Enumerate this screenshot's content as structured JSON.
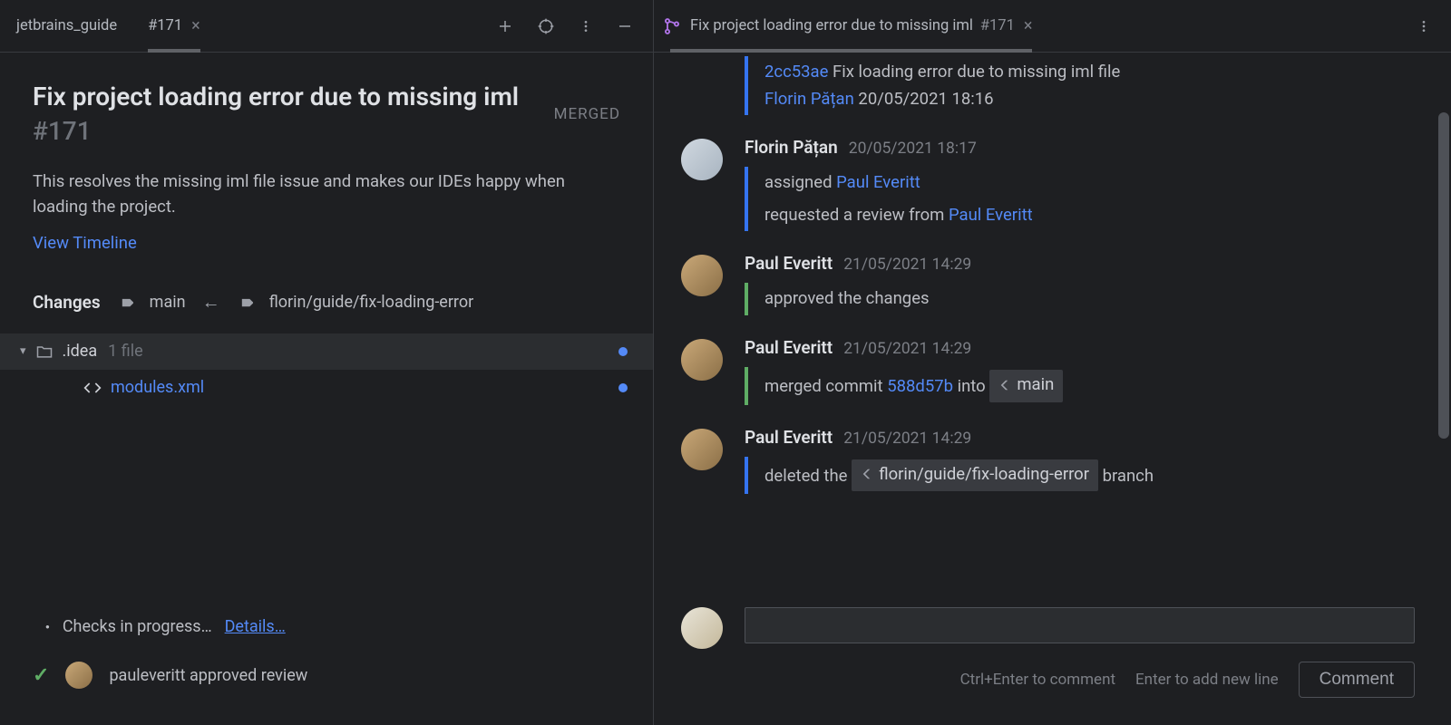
{
  "left": {
    "tabs": [
      {
        "label": "jetbrains_guide",
        "active": false
      },
      {
        "label": "#171",
        "active": true
      }
    ],
    "pr_title": "Fix project loading error due to missing iml",
    "pr_number": "#171",
    "pr_status": "MERGED",
    "description": "This resolves the missing iml file issue and makes our IDEs happy when loading the project.",
    "view_timeline": "View Timeline",
    "changes_label": "Changes",
    "base_branch": "main",
    "head_branch": "florin/guide/fix-loading-error",
    "folder": ".idea",
    "folder_count": "1 file",
    "file": "modules.xml",
    "checks": "Checks in progress…",
    "details": "Details…",
    "approval": {
      "user": "pauleveritt",
      "text": "approved review"
    }
  },
  "right": {
    "tab_title": "Fix project loading error due to missing iml",
    "tab_number": "#171",
    "partial": {
      "commit_hash": "2cc53ae",
      "commit_msg": "Fix loading error due to missing iml file",
      "author": "Florin Pățan",
      "time": "20/05/2021 18:16"
    },
    "items": [
      {
        "author": "Florin Pățan",
        "time": "20/05/2021 18:17",
        "avatar": "florin",
        "events": [
          {
            "color": "blue",
            "html": "assigned <span class='link'>Paul Everitt</span>"
          },
          {
            "color": "blue",
            "html": "requested a review from <span class='link'>Paul Everitt</span>"
          }
        ]
      },
      {
        "author": "Paul Everitt",
        "time": "21/05/2021 14:29",
        "avatar": "paul",
        "events": [
          {
            "color": "green",
            "html": "approved the changes"
          }
        ]
      },
      {
        "author": "Paul Everitt",
        "time": "21/05/2021 14:29",
        "avatar": "paul",
        "events": [
          {
            "color": "green",
            "html": "merged commit <span class='commit-hash'>588d57b</span> into <span class='branch-chip'><svg width='14' height='14' viewBox='0 0 24 24' fill='#9da0a8'><path d='M21 7l-9 9-9-9V3l9 9 9-9z' transform='rotate(90 12 12)'/></svg>main</span>"
          }
        ]
      },
      {
        "author": "Paul Everitt",
        "time": "21/05/2021 14:29",
        "avatar": "paul",
        "events": [
          {
            "color": "blue",
            "html": "deleted the <span class='branch-chip'><svg width='14' height='14' viewBox='0 0 24 24' fill='#9da0a8'><path d='M21 7l-9 9-9-9V3l9 9 9-9z' transform='rotate(90 12 12)'/></svg>florin/guide/fix-loading-error</span> branch"
          }
        ]
      }
    ],
    "composer": {
      "hint1": "Ctrl+Enter to comment",
      "hint2": "Enter to add new line",
      "button": "Comment"
    }
  }
}
